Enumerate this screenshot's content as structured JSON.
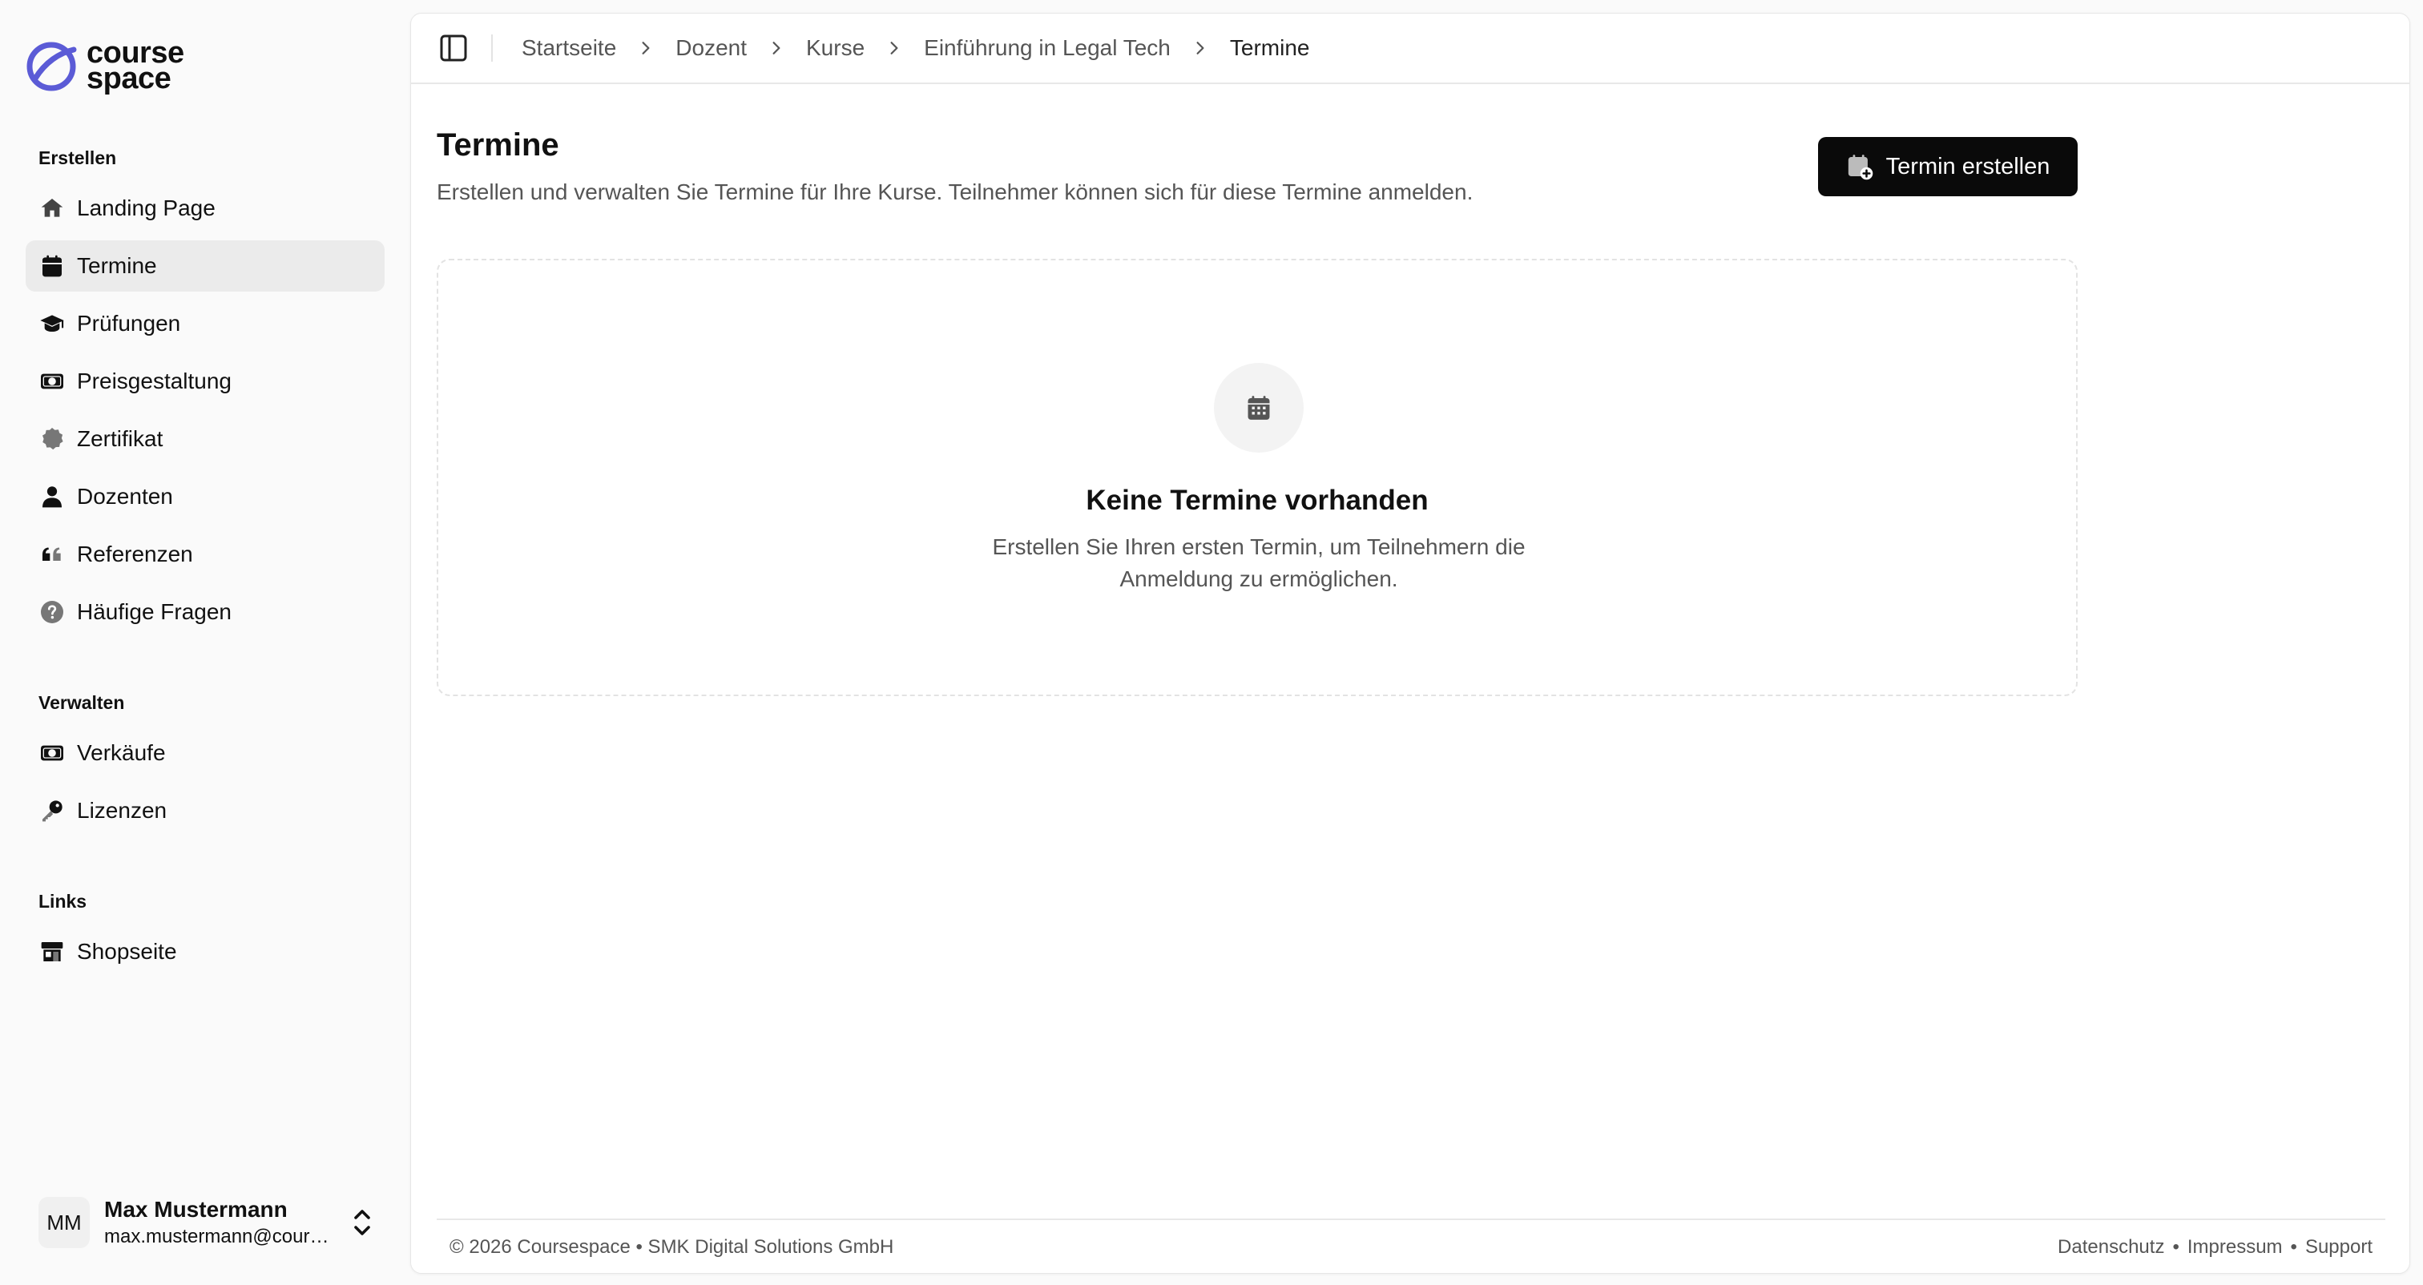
{
  "brand": {
    "line1": "course",
    "line2": "space",
    "color": "#5b5bd6"
  },
  "sidebar": {
    "groups": [
      {
        "label": "Erstellen"
      },
      {
        "label": "Verwalten"
      },
      {
        "label": "Links"
      }
    ],
    "items": [
      {
        "label": "Landing Page",
        "icon": "home-icon"
      },
      {
        "label": "Termine",
        "icon": "calendar-icon",
        "active": true
      },
      {
        "label": "Prüfungen",
        "icon": "graduation-cap-icon"
      },
      {
        "label": "Preisgestaltung",
        "icon": "banknote-icon"
      },
      {
        "label": "Zertifikat",
        "icon": "badge-icon"
      },
      {
        "label": "Dozenten",
        "icon": "user-icon"
      },
      {
        "label": "Referenzen",
        "icon": "quote-icon"
      },
      {
        "label": "Häufige Fragen",
        "icon": "help-circle-icon"
      },
      {
        "label": "Verkäufe",
        "icon": "banknote-icon"
      },
      {
        "label": "Lizenzen",
        "icon": "key-icon"
      },
      {
        "label": "Shopseite",
        "icon": "store-icon"
      }
    ]
  },
  "user": {
    "initials": "MM",
    "name": "Max Mustermann",
    "email": "max.mustermann@coursespace.de"
  },
  "breadcrumb": [
    "Startseite",
    "Dozent",
    "Kurse",
    "Einführung in Legal Tech",
    "Termine"
  ],
  "page": {
    "title": "Termine",
    "description": "Erstellen und verwalten Sie Termine für Ihre Kurse. Teilnehmer können sich für diese Termine anmelden.",
    "create_button": "Termin erstellen"
  },
  "empty_state": {
    "title": "Keine Termine vorhanden",
    "text": "Erstellen Sie Ihren ersten Termin, um Teilnehmern die Anmeldung zu ermöglichen."
  },
  "footer": {
    "copyright": "© 2026 Coursespace • SMK Digital Solutions GmbH",
    "links": [
      "Datenschutz",
      "Impressum",
      "Support"
    ],
    "separator": "•"
  }
}
